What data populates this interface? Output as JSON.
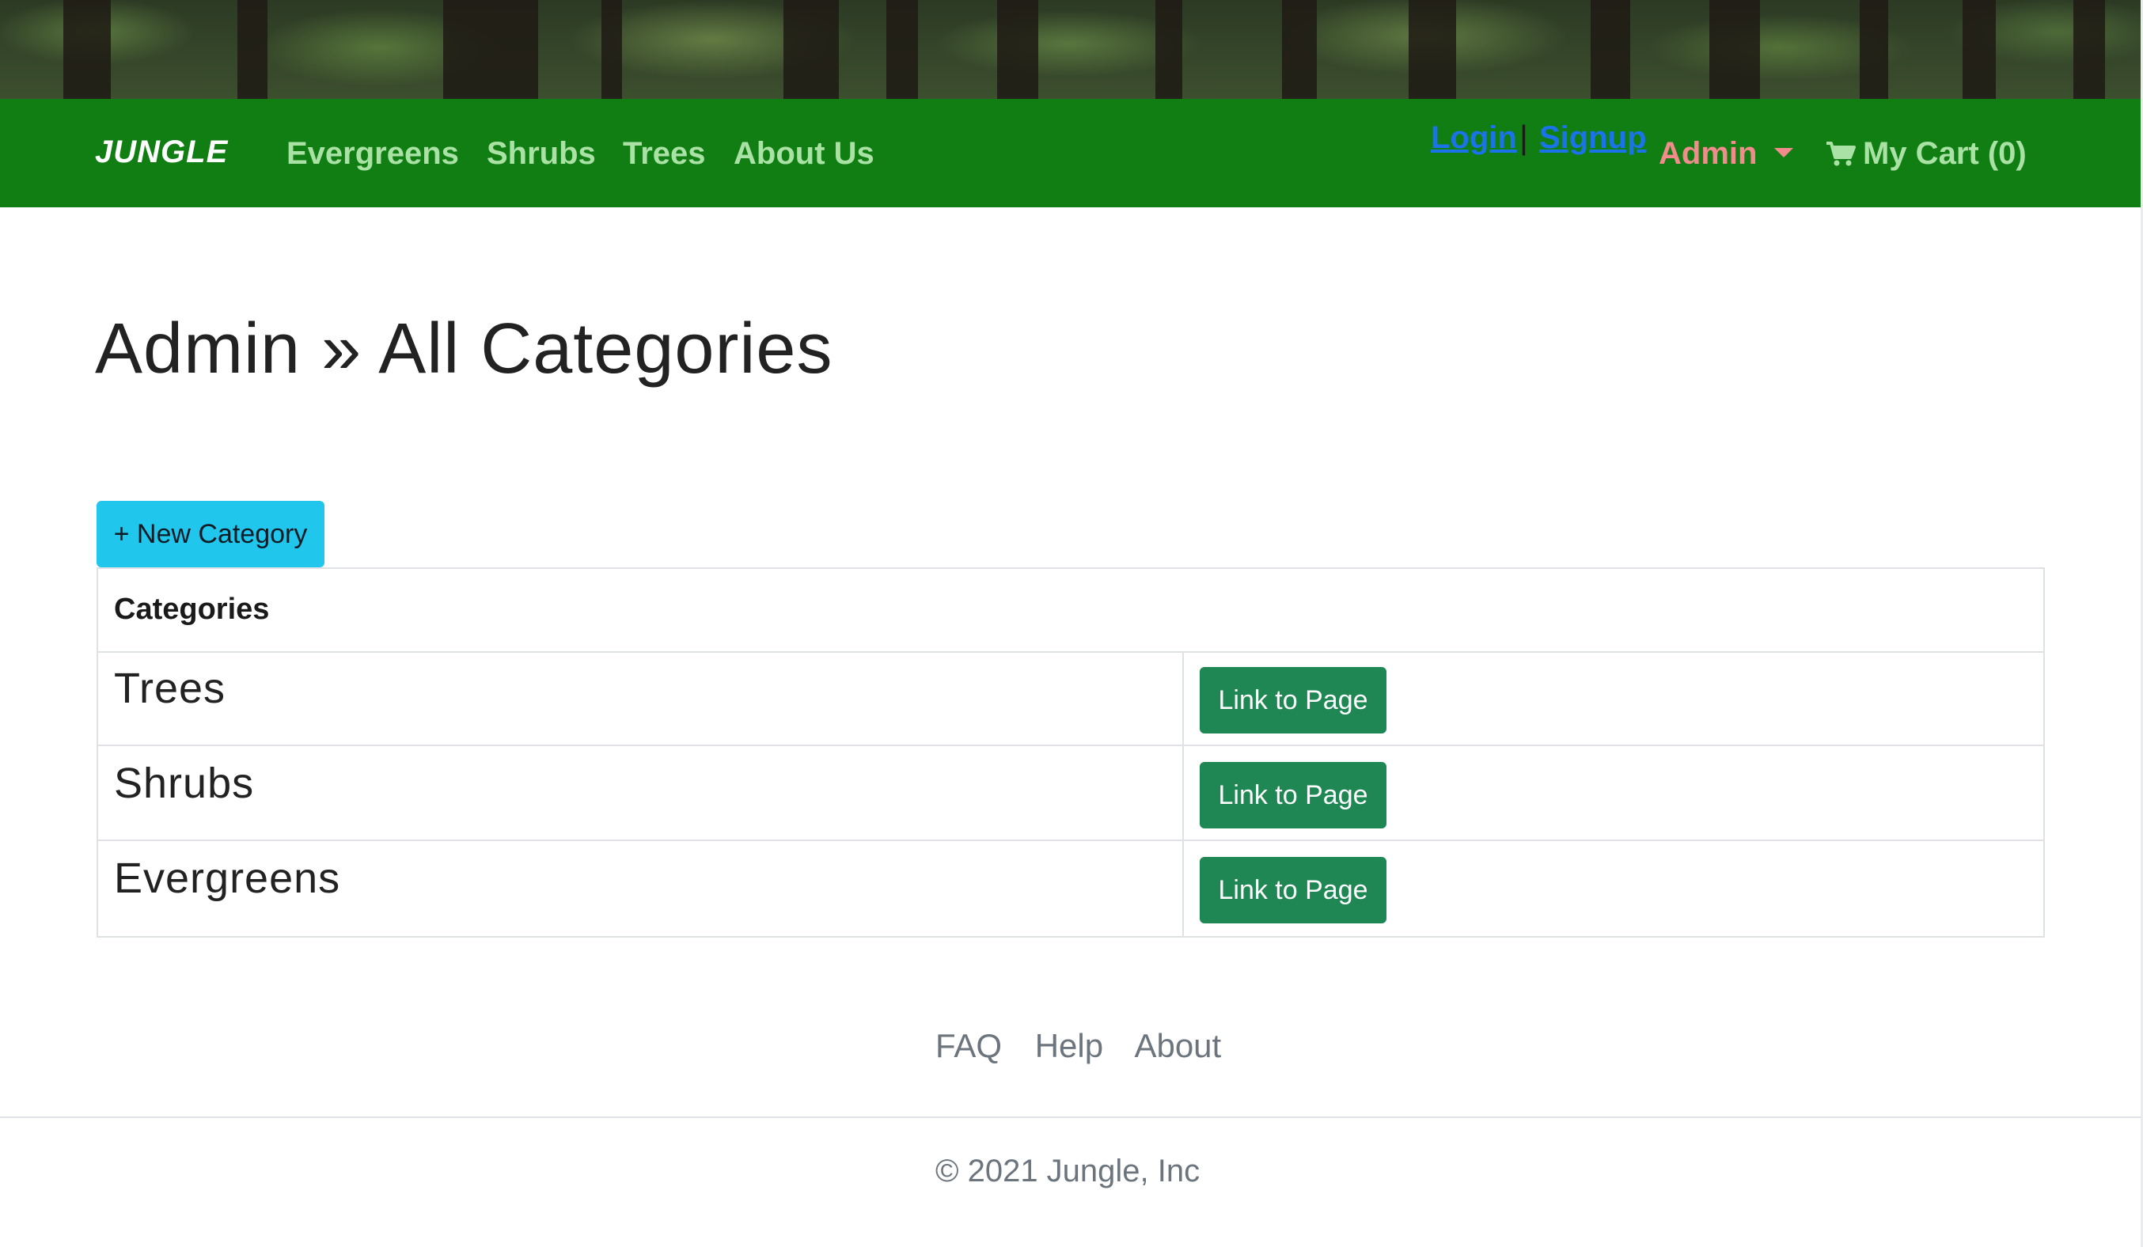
{
  "navbar": {
    "brand": "JUNGLE",
    "links": [
      "Evergreens",
      "Shrubs",
      "Trees",
      "About Us"
    ],
    "login": "Login",
    "separator": "|",
    "signup": "Signup",
    "admin": "Admin",
    "cart": "My Cart (0)"
  },
  "page": {
    "title": "Admin » All Categories",
    "new_button": "+ New Category"
  },
  "table": {
    "header": "Categories",
    "rows": [
      {
        "name": "Trees",
        "action": "Link to Page"
      },
      {
        "name": "Shrubs",
        "action": "Link to Page"
      },
      {
        "name": "Evergreens",
        "action": "Link to Page"
      }
    ]
  },
  "footer": {
    "links": [
      "FAQ",
      "Help",
      "About"
    ],
    "copyright": "© 2021 Jungle, Inc"
  },
  "colors": {
    "navbar_bg": "#117e13",
    "nav_link": "#a9e2a4",
    "auth_link": "#1a73e8",
    "admin": "#f28c8c",
    "new_button": "#20c6ec",
    "link_button": "#1f8754"
  }
}
